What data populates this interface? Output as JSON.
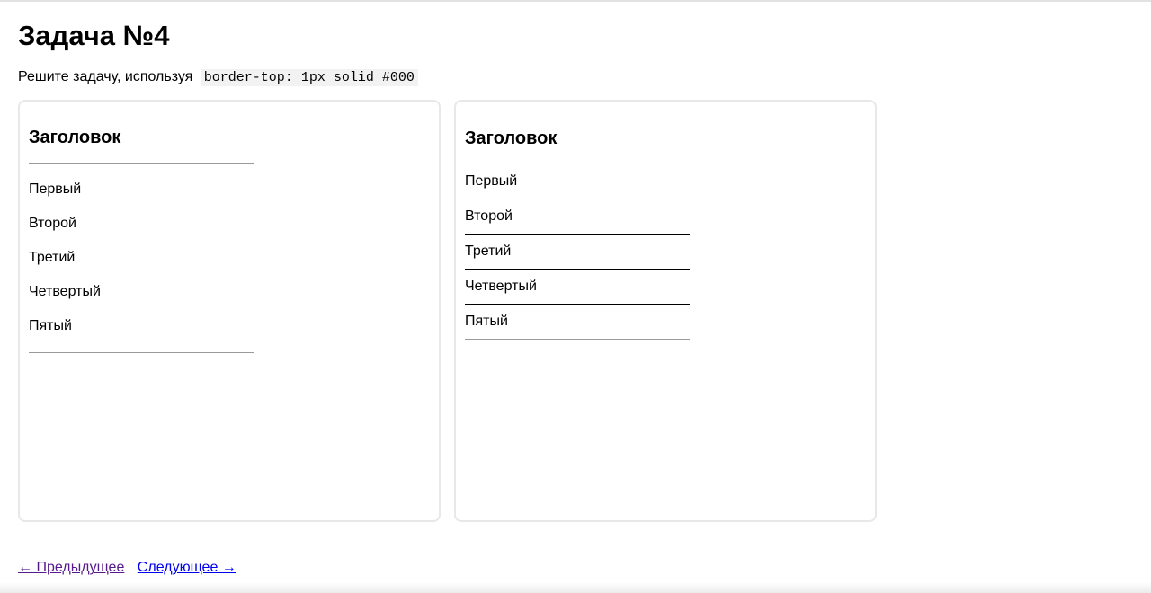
{
  "page": {
    "title": "Задача №4",
    "task_prefix": "Решите задачу, используя",
    "task_code": "border-top: 1px solid #000"
  },
  "left_example": {
    "heading": "Заголовок",
    "items": [
      "Первый",
      "Второй",
      "Третий",
      "Четвертый",
      "Пятый"
    ]
  },
  "right_example": {
    "heading": "Заголовок",
    "items": [
      "Первый",
      "Второй",
      "Третий",
      "Четвертый",
      "Пятый"
    ]
  },
  "pagination": {
    "prev_label": "← Предыдущее",
    "next_label": "Следующее →"
  },
  "colors": {
    "visited_link": "#551a8b",
    "link": "#0000ee",
    "card_border": "#e8e8e8",
    "divider": "#9a9a9a",
    "item_border": "#000000"
  }
}
